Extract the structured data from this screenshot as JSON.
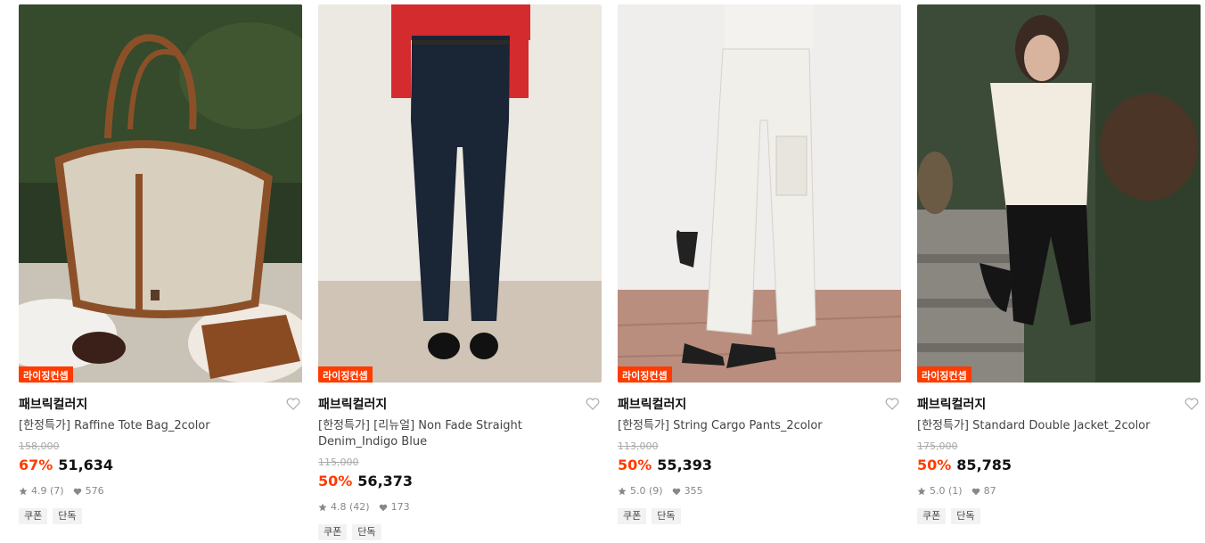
{
  "products": [
    {
      "badge": "라이징컨셉",
      "brand": "패브릭컬러지",
      "name": "[한정특가] Raffine Tote Bag_2color",
      "original_price": "158,000",
      "discount": "67%",
      "price": "51,634",
      "rating": "4.9 (7)",
      "likes": "576",
      "tags": [
        "쿠폰",
        "단독"
      ]
    },
    {
      "badge": "라이징컨셉",
      "brand": "패브릭컬러지",
      "name": "[한정특가] [리뉴얼] Non Fade Straight Denim_Indigo Blue",
      "original_price": "115,000",
      "discount": "50%",
      "price": "56,373",
      "rating": "4.8 (42)",
      "likes": "173",
      "tags": [
        "쿠폰",
        "단독"
      ]
    },
    {
      "badge": "라이징컨셉",
      "brand": "패브릭컬러지",
      "name": "[한정특가] String Cargo Pants_2color",
      "original_price": "113,000",
      "discount": "50%",
      "price": "55,393",
      "rating": "5.0 (9)",
      "likes": "355",
      "tags": [
        "쿠폰",
        "단독"
      ]
    },
    {
      "badge": "라이징컨셉",
      "brand": "패브릭컬러지",
      "name": "[한정특가] Standard Double Jacket_2color",
      "original_price": "175,000",
      "discount": "50%",
      "price": "85,785",
      "rating": "5.0 (1)",
      "likes": "87",
      "tags": [
        "쿠폰",
        "단독"
      ]
    }
  ],
  "colors": {
    "accent": "#ff3b00",
    "tag_bg": "#f2f2f2"
  },
  "icons": {
    "star": "star-icon",
    "like": "heart-small-icon",
    "wishlist": "heart-outline-icon"
  }
}
